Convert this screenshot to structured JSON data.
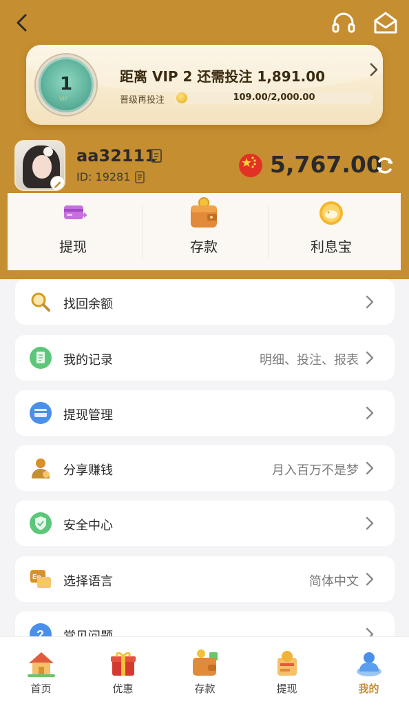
{
  "header": {
    "back_icon": "chevron-left-icon",
    "support_icon": "headset-icon",
    "mail_icon": "mail-icon"
  },
  "vip": {
    "level": "1",
    "title": "距离 VIP 2 还需投注 1,891.00",
    "progress_label": "晋级再投注",
    "progress_text": "109.00/2,000.00",
    "progress_fraction": 0.0545
  },
  "profile": {
    "username": "aa32111",
    "id_text": "ID: 19281",
    "balance": "5,767.00",
    "currency_flag": "china-flag-icon"
  },
  "quick_actions": [
    {
      "label": "提现",
      "icon": "withdraw-card-icon"
    },
    {
      "label": "存款",
      "icon": "wallet-icon"
    },
    {
      "label": "利息宝",
      "icon": "piggy-bank-icon"
    }
  ],
  "menu": [
    {
      "title": "找回余额",
      "hint": "",
      "icon": "search-icon"
    },
    {
      "title": "我的记录",
      "hint": "明细、投注、报表",
      "icon": "record-icon"
    },
    {
      "title": "提现管理",
      "hint": "",
      "icon": "card-icon"
    },
    {
      "title": "分享赚钱",
      "hint": "月入百万不是梦",
      "icon": "agent-icon"
    },
    {
      "title": "安全中心",
      "hint": "",
      "icon": "shield-icon"
    },
    {
      "title": "选择语言",
      "hint": "简体中文",
      "icon": "language-icon"
    },
    {
      "title": "常见问题",
      "hint": "",
      "icon": "question-icon"
    }
  ],
  "tabs": [
    {
      "label": "首页",
      "icon": "home-icon"
    },
    {
      "label": "优惠",
      "icon": "gift-icon"
    },
    {
      "label": "存款",
      "icon": "wallet-icon"
    },
    {
      "label": "提现",
      "icon": "withdraw-icon"
    },
    {
      "label": "我的",
      "icon": "profile-icon",
      "active": true
    }
  ],
  "colors": {
    "brand": "#c58e31",
    "background": "#f4f4f6"
  }
}
